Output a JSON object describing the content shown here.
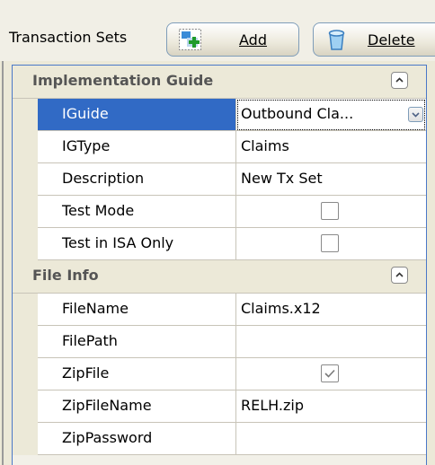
{
  "toolbar": {
    "label": "Transaction Sets",
    "add_label": "Add",
    "delete_label": "Delete"
  },
  "categories": [
    {
      "title": "Implementation Guide",
      "rows": [
        {
          "name": "IGuide",
          "value": "Outbound Cla..."
        },
        {
          "name": "IGType",
          "value": "Claims"
        },
        {
          "name": "Description",
          "value": "New Tx Set"
        },
        {
          "name": "Test Mode",
          "checked": false
        },
        {
          "name": "Test in ISA Only",
          "checked": false
        }
      ]
    },
    {
      "title": "File Info",
      "rows": [
        {
          "name": "FileName",
          "value": "Claims.x12"
        },
        {
          "name": "FilePath",
          "value": ""
        },
        {
          "name": "ZipFile",
          "checked": true
        },
        {
          "name": "ZipFileName",
          "value": "RELH.zip"
        },
        {
          "name": "ZipPassword",
          "value": ""
        }
      ]
    }
  ],
  "icons": {
    "add": "add-item-icon",
    "delete": "trash-icon",
    "collapse": "chevron-up-icon",
    "dropdown": "chevron-down-icon",
    "check": "check-icon"
  },
  "colors": {
    "selection": "#316ac5",
    "frame": "#4a78c8"
  }
}
